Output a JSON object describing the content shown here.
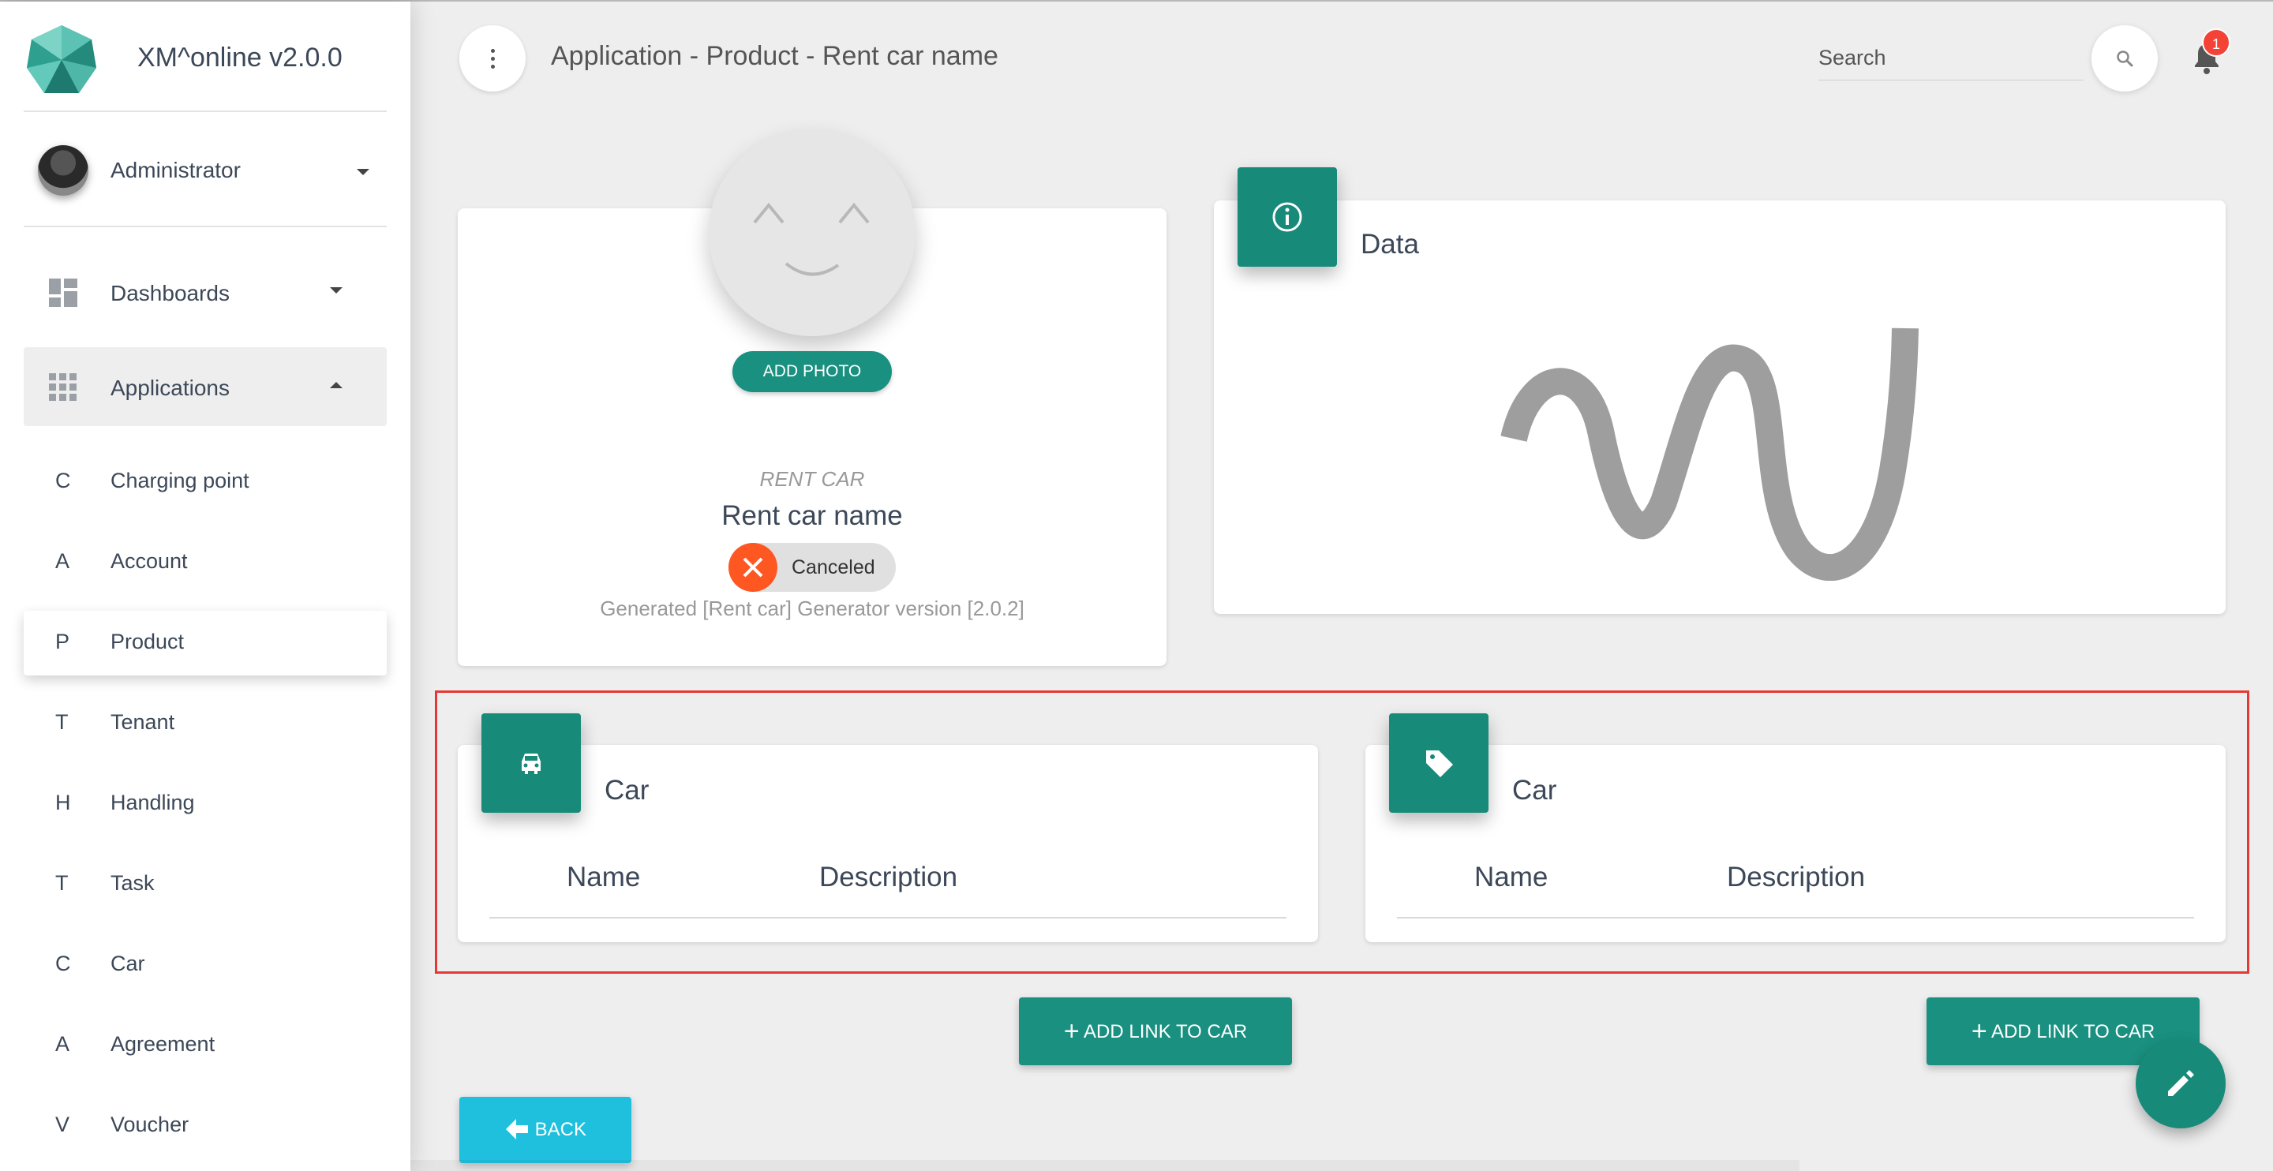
{
  "app": {
    "name": "XM^online v2.0.0"
  },
  "user": {
    "name": "Administrator"
  },
  "nav": {
    "dashboards": "Dashboards",
    "applications": "Applications",
    "items": [
      {
        "letter": "C",
        "label": "Charging point"
      },
      {
        "letter": "A",
        "label": "Account"
      },
      {
        "letter": "P",
        "label": "Product"
      },
      {
        "letter": "T",
        "label": "Tenant"
      },
      {
        "letter": "H",
        "label": "Handling"
      },
      {
        "letter": "T",
        "label": "Task"
      },
      {
        "letter": "C",
        "label": "Car"
      },
      {
        "letter": "A",
        "label": "Agreement"
      },
      {
        "letter": "V",
        "label": "Voucher"
      }
    ]
  },
  "header": {
    "breadcrumb": "Application - Product - Rent car name",
    "search_placeholder": "Search",
    "notification_count": "1"
  },
  "profile": {
    "add_photo_label": "ADD PHOTO",
    "category": "RENT CAR",
    "name": "Rent car name",
    "status": "Canceled",
    "generated": "Generated [Rent car] Generator version [2.0.2]"
  },
  "data_card": {
    "title": "Data"
  },
  "link_cards": [
    {
      "title": "Car",
      "columns": [
        "Name",
        "Description"
      ],
      "icon": "car-icon"
    },
    {
      "title": "Car",
      "columns": [
        "Name",
        "Description"
      ],
      "icon": "tag-icon"
    }
  ],
  "actions": {
    "add_link_label": "ADD LINK TO CAR",
    "back_label": "BACK"
  },
  "colors": {
    "primary": "#1a9080",
    "info": "#1fc0dd",
    "danger": "#f44336",
    "status_canceled": "#ff5722",
    "highlight": "#e53935"
  }
}
